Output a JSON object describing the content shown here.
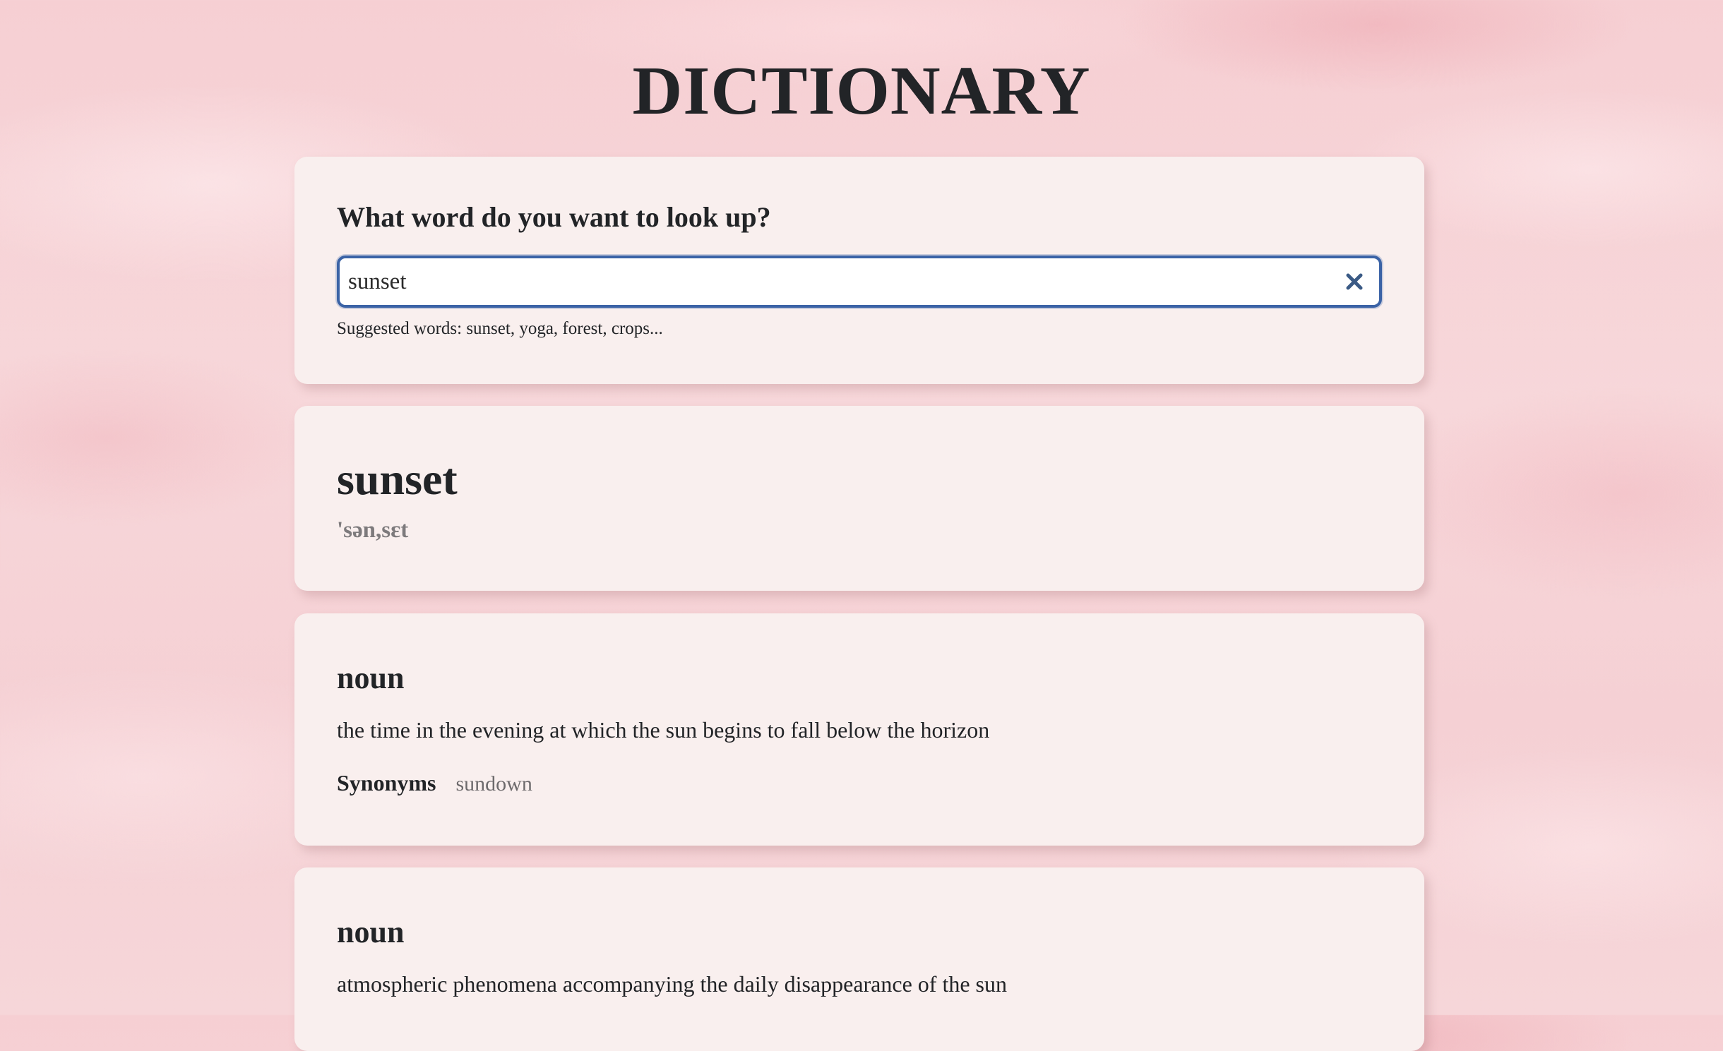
{
  "app": {
    "title": "DICTIONARY"
  },
  "search": {
    "heading": "What word do you want to look up?",
    "value": "sunset",
    "placeholder": "",
    "clear_icon": "close-icon",
    "suggested_text": "Suggested words: sunset, yoga, forest, crops..."
  },
  "result": {
    "word": "sunset",
    "phonetic": "'sən,sɛt"
  },
  "meanings": [
    {
      "part_of_speech": "noun",
      "definition": "the time in the evening at which the sun begins to fall below the horizon",
      "synonyms_label": "Synonyms",
      "synonyms": [
        "sundown"
      ]
    },
    {
      "part_of_speech": "noun",
      "definition": "atmospheric phenomena accompanying the daily disappearance of the sun"
    }
  ],
  "colors": {
    "accent": "#3b63a6",
    "card_background": "#f9efee",
    "text": "#222427",
    "muted_text": "#6d6a6c"
  }
}
